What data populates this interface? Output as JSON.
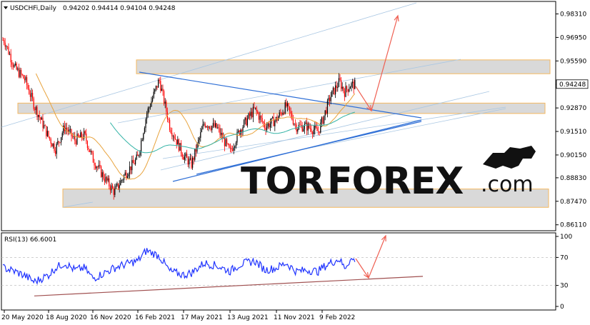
{
  "chart_data": [
    {
      "type": "candlestick",
      "title": "USDCHFi,Daily",
      "ohlc": "0.94202 0.94414 0.94104 0.94248",
      "current_price": "0.94248",
      "current_price_value": 0.94248,
      "ylim": [
        0.8585,
        0.9895
      ],
      "y_ticks": [
        "0.98310",
        "0.96950",
        "0.95590",
        "0.94230",
        "0.92870",
        "0.91510",
        "0.90150",
        "0.88830",
        "0.87470",
        "0.86110"
      ],
      "y_tick_values": [
        0.9831,
        0.9695,
        0.9559,
        0.9423,
        0.9287,
        0.9151,
        0.9015,
        0.8883,
        0.8747,
        0.8611
      ],
      "x_ticks": [
        "20 May 2020",
        "18 Aug 2020",
        "16 Nov 2020",
        "16 Feb 2021",
        "17 May 2021",
        "13 Aug 2021",
        "11 Nov 2021",
        "9 Feb 2022"
      ],
      "price_path": [
        [
          "2020-05-20",
          0.968
        ],
        [
          "2020-06-10",
          0.952
        ],
        [
          "2020-07-01",
          0.945
        ],
        [
          "2020-07-20",
          0.93
        ],
        [
          "2020-08-18",
          0.912
        ],
        [
          "2020-09-01",
          0.905
        ],
        [
          "2020-09-20",
          0.918
        ],
        [
          "2020-10-10",
          0.91
        ],
        [
          "2020-10-30",
          0.913
        ],
        [
          "2020-11-16",
          0.899
        ],
        [
          "2020-12-10",
          0.888
        ],
        [
          "2020-12-30",
          0.88
        ],
        [
          "2021-01-20",
          0.89
        ],
        [
          "2021-02-16",
          0.9
        ],
        [
          "2021-03-05",
          0.925
        ],
        [
          "2021-03-30",
          0.945
        ],
        [
          "2021-04-20",
          0.918
        ],
        [
          "2021-05-17",
          0.901
        ],
        [
          "2021-06-01",
          0.896
        ],
        [
          "2021-06-25",
          0.92
        ],
        [
          "2021-07-20",
          0.917
        ],
        [
          "2021-08-13",
          0.903
        ],
        [
          "2021-09-01",
          0.916
        ],
        [
          "2021-09-30",
          0.928
        ],
        [
          "2021-10-20",
          0.918
        ],
        [
          "2021-11-11",
          0.922
        ],
        [
          "2021-11-30",
          0.93
        ],
        [
          "2021-12-20",
          0.918
        ],
        [
          "2022-01-10",
          0.918
        ],
        [
          "2022-02-01",
          0.915
        ],
        [
          "2022-02-09",
          0.921
        ],
        [
          "2022-02-25",
          0.935
        ],
        [
          "2022-03-15",
          0.944
        ],
        [
          "2022-03-25",
          0.938
        ],
        [
          "2022-04-05",
          0.942
        ]
      ],
      "colors": {
        "bull": "#000000",
        "bear": "#ff0000",
        "ma_fast": "#e8a33d",
        "ma_slow": "#33b3a6",
        "trend": "#2f6fd6",
        "channel": "#a9c7e3",
        "zone_fill": "#d9d9d9",
        "zone_border": "#f4b860",
        "arrow": "#ef5f52"
      }
    },
    {
      "type": "line",
      "title": "RSI(13) 66.6001",
      "ylim": [
        0,
        100
      ],
      "y_ticks": [
        "100",
        "70",
        "30",
        "0"
      ],
      "y_tick_values": [
        100,
        70,
        30,
        0
      ],
      "rsi_path": [
        [
          "2020-05-20",
          55
        ],
        [
          "2020-06-10",
          50
        ],
        [
          "2020-07-01",
          44
        ],
        [
          "2020-07-20",
          35
        ],
        [
          "2020-08-18",
          45
        ],
        [
          "2020-09-01",
          55
        ],
        [
          "2020-09-20",
          62
        ],
        [
          "2020-10-10",
          52
        ],
        [
          "2020-10-30",
          55
        ],
        [
          "2020-11-16",
          40
        ],
        [
          "2020-12-10",
          48
        ],
        [
          "2020-12-30",
          55
        ],
        [
          "2021-01-20",
          60
        ],
        [
          "2021-02-16",
          65
        ],
        [
          "2021-03-05",
          80
        ],
        [
          "2021-03-30",
          72
        ],
        [
          "2021-04-20",
          50
        ],
        [
          "2021-05-17",
          45
        ],
        [
          "2021-06-01",
          48
        ],
        [
          "2021-06-25",
          62
        ],
        [
          "2021-07-20",
          58
        ],
        [
          "2021-08-13",
          50
        ],
        [
          "2021-09-01",
          60
        ],
        [
          "2021-09-30",
          65
        ],
        [
          "2021-10-20",
          52
        ],
        [
          "2021-11-11",
          55
        ],
        [
          "2021-11-30",
          62
        ],
        [
          "2021-12-20",
          50
        ],
        [
          "2022-01-10",
          52
        ],
        [
          "2022-02-01",
          50
        ],
        [
          "2022-02-09",
          55
        ],
        [
          "2022-02-25",
          62
        ],
        [
          "2022-03-15",
          68
        ],
        [
          "2022-03-25",
          55
        ],
        [
          "2022-04-05",
          66.6
        ]
      ]
    }
  ],
  "watermark": {
    "logo_text": "TORFOREX",
    "logo_suffix": ".com"
  }
}
